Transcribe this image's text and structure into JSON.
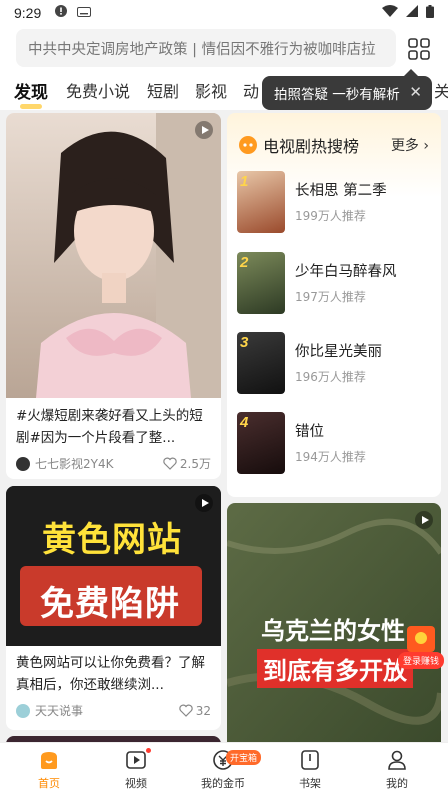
{
  "status": {
    "time": "9:29"
  },
  "search": {
    "placeholder": "中共中央定调房地产政策 | 情侣因不雅行为被咖啡店拉"
  },
  "tabs": [
    "发现",
    "免费小说",
    "短剧",
    "影视",
    "动",
    "关"
  ],
  "tooltip": {
    "text": "拍照答疑 一秒有解析",
    "close": "✕"
  },
  "cards": [
    {
      "title": "#火爆短剧来袭好看又上头的短剧#因为一个片段看了整...",
      "author": "七七影视2Y4K",
      "likes": "2.5万",
      "overlay": []
    },
    {
      "title": "黄色网站可以让你免费看？了解真相后，你还敢继续浏...",
      "author": "天天说事",
      "likes": "32",
      "overlay": [
        "黄色网站",
        "免费陷阱"
      ]
    },
    {
      "title": "",
      "author": "",
      "likes": "",
      "overlay": [
        "乌克兰的女性",
        "到底有多开放"
      ]
    }
  ],
  "ranking": {
    "title": "电视剧热搜榜",
    "more": "更多",
    "items": [
      {
        "rank": "1",
        "name": "长相思 第二季",
        "count": "199万人推荐"
      },
      {
        "rank": "2",
        "name": "少年白马醉春风",
        "count": "197万人推荐"
      },
      {
        "rank": "3",
        "name": "你比星光美丽",
        "count": "196万人推荐"
      },
      {
        "rank": "4",
        "name": "错位",
        "count": "194万人推荐"
      }
    ]
  },
  "floating": {
    "label": "登录赚钱"
  },
  "nav": {
    "items": [
      {
        "label": "首页",
        "icon": "home-icon"
      },
      {
        "label": "视频",
        "icon": "video-icon"
      },
      {
        "label": "我的金币",
        "icon": "coin-icon"
      },
      {
        "label": "书架",
        "icon": "bookshelf-icon"
      },
      {
        "label": "我的",
        "icon": "user-icon"
      }
    ],
    "badge": "开宝箱"
  },
  "colors": {
    "accent": "#ff8a00",
    "tab_underline": "#ffc93a"
  }
}
